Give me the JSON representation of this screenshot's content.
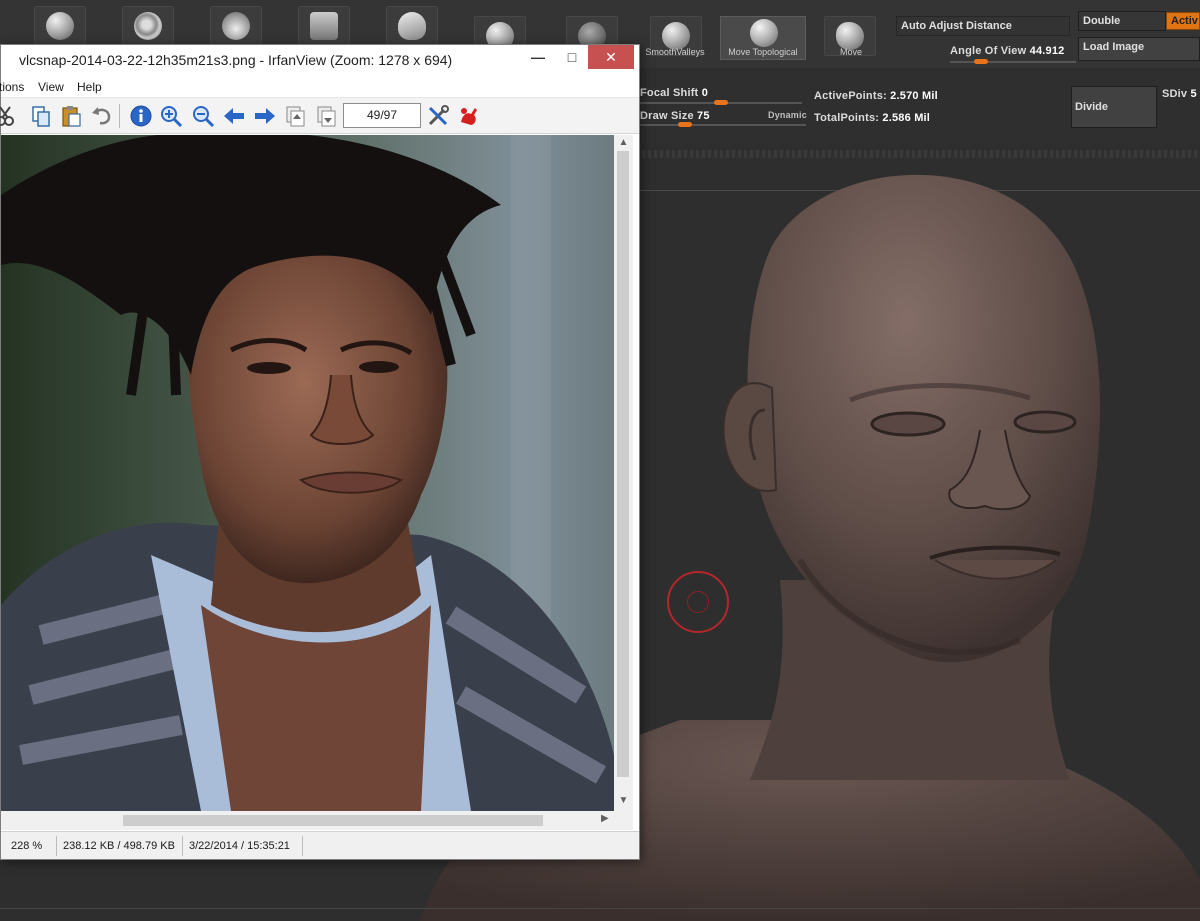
{
  "zbrush": {
    "brushes": [
      {
        "label": "",
        "icon": "sphere-brush-icon"
      },
      {
        "label": "",
        "icon": "spiral-brush-icon"
      },
      {
        "label": "",
        "icon": "fur-brush-icon"
      },
      {
        "label": "",
        "icon": "insert-brush-icon"
      },
      {
        "label": "",
        "icon": "wave-brush-icon"
      },
      {
        "label": "",
        "icon": "ball-brush-icon"
      },
      {
        "label": "",
        "icon": "noise-brush-icon"
      },
      {
        "label": "SmoothValleys",
        "icon": "smooth-valleys-icon"
      },
      {
        "label": "Move Topological",
        "icon": "move-topological-icon"
      },
      {
        "label": "Move",
        "icon": "move-brush-icon"
      }
    ],
    "auto_adjust_distance": "Auto Adjust Distance",
    "angle_of_view_label": "Angle Of View",
    "angle_of_view_value": "44.912",
    "double_label": "Double",
    "active_label": "Activ",
    "load_image_label": "Load Image",
    "focal_shift_label": "Focal Shift",
    "focal_shift_value": "0",
    "draw_size_label": "Draw Size",
    "draw_size_value": "75",
    "dynamic_label": "Dynamic",
    "active_points_label": "ActivePoints:",
    "active_points_value": "2.570 Mil",
    "total_points_label": "TotalPoints:",
    "total_points_value": "2.586 Mil",
    "divide_label": "Divide",
    "sdiv_label": "SDiv",
    "sdiv_value": "5",
    "accent": "#e07412"
  },
  "irfanview": {
    "title": "vlcsnap-2014-03-22-12h35m21s3.png - IrfanView (Zoom: 1278 x 694)",
    "menu": [
      "tions",
      "View",
      "Help"
    ],
    "page_counter": "49/97",
    "status": {
      "zoom": "228 %",
      "size": "238.12 KB / 498.79 KB",
      "datetime": "3/22/2014 / 15:35:21"
    }
  }
}
